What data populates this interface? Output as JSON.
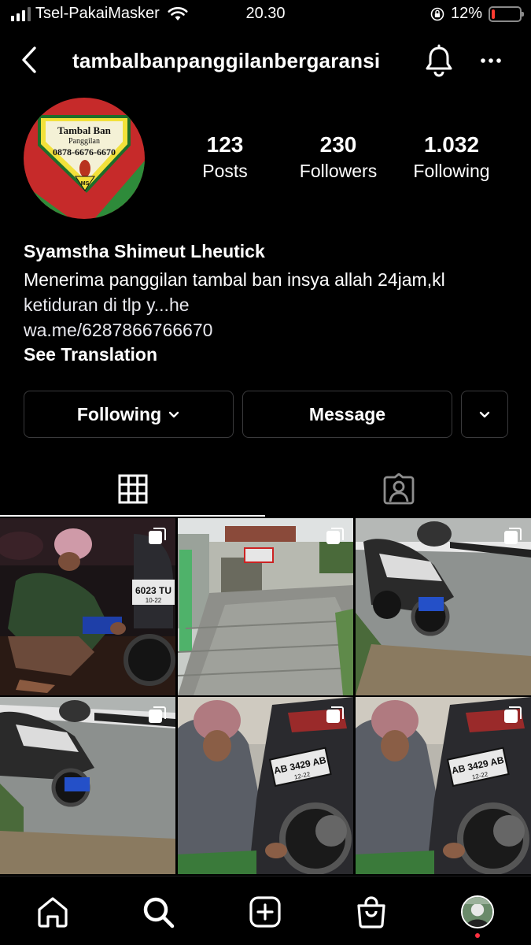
{
  "status_bar": {
    "carrier": "Tsel-PakaiMasker",
    "time": "20.30",
    "battery_text": "12%",
    "battery_level": 0.12
  },
  "header": {
    "username": "tambalbanpanggilanbergaransi"
  },
  "avatar": {
    "line1": "Tambal Ban",
    "line2": "Panggilan",
    "line3": "0878-6676-6670",
    "badge": "MS"
  },
  "stats": [
    {
      "value": "123",
      "label": "Posts"
    },
    {
      "value": "230",
      "label": "Followers"
    },
    {
      "value": "1.032",
      "label": "Following"
    }
  ],
  "bio": {
    "name": "Syamstha Shimeut Lheutick",
    "line1": "Menerima panggilan tambal ban insya allah 24jam,kl",
    "line2": "ketiduran di tlp y...he",
    "link": "wa.me/6287866766670",
    "translate": "See Translation"
  },
  "buttons": {
    "following": "Following",
    "message": "Message"
  },
  "grid": {
    "plate_a": "6023 TU",
    "plate_a_sub": "10-22",
    "plate_b": "AB 3429 AB",
    "plate_b_sub": "12-22",
    "plate_c": "AB 3429 AB",
    "plate_c_sub": "12-22"
  },
  "icons": {
    "back": "chevron-left-icon",
    "bell": "bell-icon",
    "more": "more-horizontal-icon",
    "grid_tab": "grid-icon",
    "tagged_tab": "tagged-person-icon",
    "home": "home-icon",
    "search": "search-icon",
    "create": "plus-square-icon",
    "shop": "shopping-bag-icon"
  },
  "colors": {
    "background": "#000000",
    "border": "#3a3a3c",
    "battery_low": "#ff3b30",
    "notification_dot": "#ff3040"
  }
}
